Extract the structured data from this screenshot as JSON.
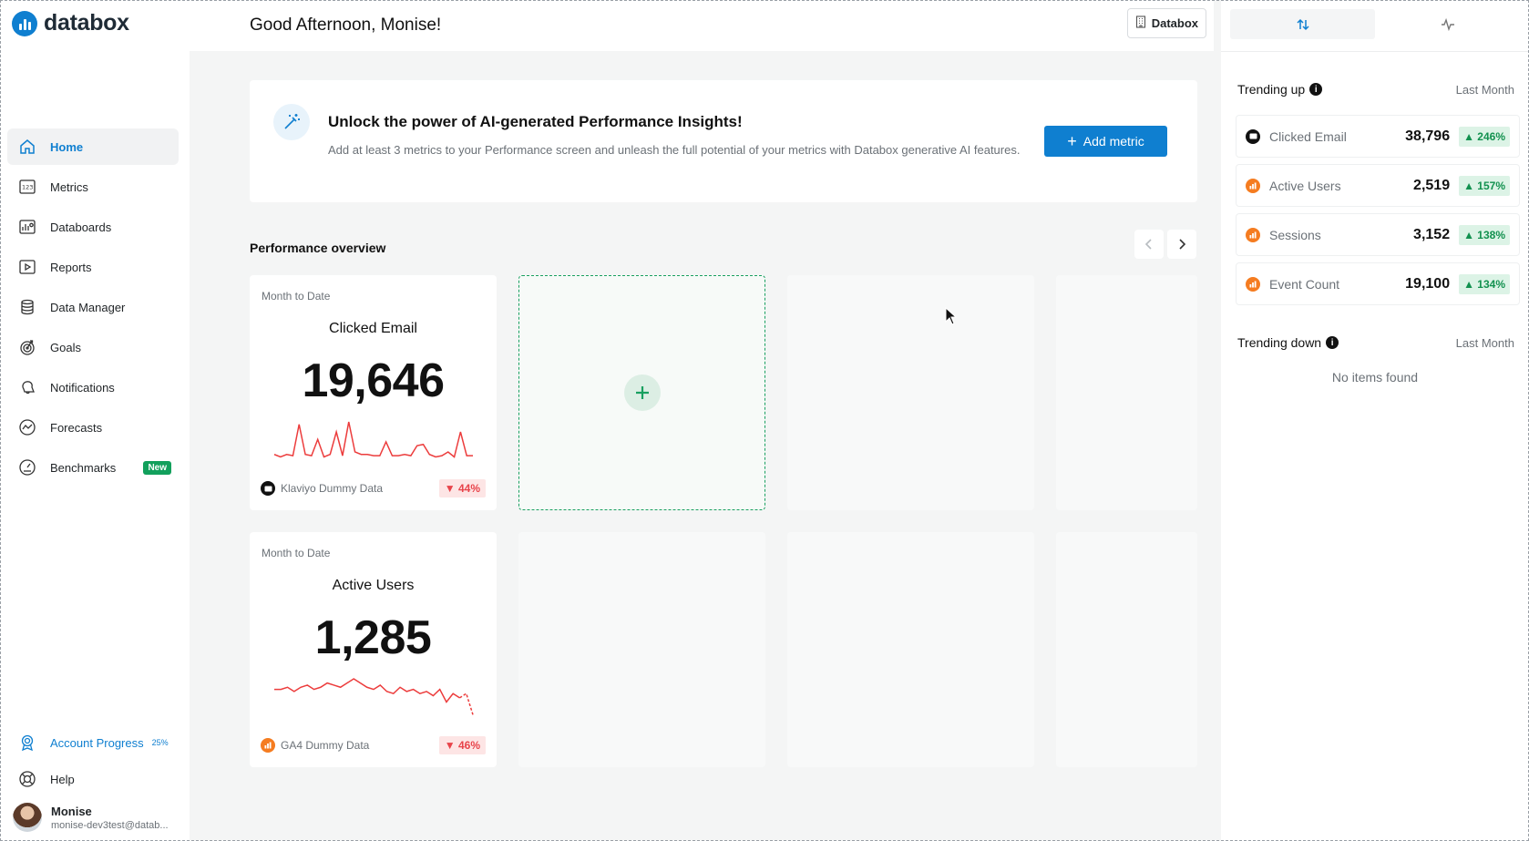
{
  "app": {
    "logo_text": "databox"
  },
  "header": {
    "greeting": "Good Afternoon, Monise!",
    "org_button": "Databox"
  },
  "nav": {
    "items": [
      {
        "id": "home",
        "label": "Home",
        "icon": "home-icon",
        "active": true
      },
      {
        "id": "metrics",
        "label": "Metrics",
        "icon": "metrics-icon"
      },
      {
        "id": "databoards",
        "label": "Databoards",
        "icon": "databoards-icon"
      },
      {
        "id": "reports",
        "label": "Reports",
        "icon": "reports-icon"
      },
      {
        "id": "data-manager",
        "label": "Data Manager",
        "icon": "database-icon"
      },
      {
        "id": "goals",
        "label": "Goals",
        "icon": "target-icon"
      },
      {
        "id": "notifications",
        "label": "Notifications",
        "icon": "bell-icon"
      },
      {
        "id": "forecasts",
        "label": "Forecasts",
        "icon": "forecast-icon"
      },
      {
        "id": "benchmarks",
        "label": "Benchmarks",
        "icon": "benchmark-icon",
        "badge": "New"
      }
    ],
    "account_progress": {
      "label": "Account Progress",
      "percent": "25%"
    },
    "help_label": "Help",
    "user": {
      "name": "Monise",
      "email": "monise-dev3test@datab..."
    }
  },
  "banner": {
    "title": "Unlock the power of AI-generated Performance Insights!",
    "description": "Add at least 3 metrics to your Performance screen and unleash the full potential of your metrics with Databox generative AI features.",
    "button_label": "Add metric"
  },
  "performance": {
    "title": "Performance overview",
    "cards": [
      {
        "period": "Month to Date",
        "name": "Clicked Email",
        "value": "19,646",
        "source": "Klaviyo Dummy Data",
        "change": "▼ 44%",
        "spark": [
          3,
          2,
          3,
          2.5,
          15,
          3,
          2.5,
          9,
          2,
          3,
          12,
          2.5,
          16,
          4,
          3,
          3,
          2.5,
          2.5,
          8,
          2.5,
          2.5,
          3,
          2.5,
          6.5,
          7,
          3,
          2,
          2.5,
          4,
          2,
          12,
          2.5,
          2.5
        ]
      },
      {
        "period": "Month to Date",
        "name": "Active Users",
        "value": "1,285",
        "source": "GA4 Dummy Data",
        "change": "▼ 46%",
        "spark": [
          14,
          14,
          15,
          13,
          15,
          16,
          14,
          15,
          17,
          16,
          15,
          17,
          19,
          17,
          15,
          14,
          16,
          13,
          12,
          15,
          13,
          14,
          12,
          13,
          11,
          14,
          8,
          12,
          10,
          12,
          2
        ]
      }
    ]
  },
  "trending_up": {
    "title": "Trending up",
    "period": "Last Month",
    "items": [
      {
        "name": "Clicked Email",
        "value": "38,796",
        "change": "▲ 246%",
        "source_icon": "klaviyo-icon"
      },
      {
        "name": "Active Users",
        "value": "2,519",
        "change": "▲ 157%",
        "source_icon": "ga4-icon"
      },
      {
        "name": "Sessions",
        "value": "3,152",
        "change": "▲ 138%",
        "source_icon": "ga4-icon"
      },
      {
        "name": "Event Count",
        "value": "19,100",
        "change": "▲ 134%",
        "source_icon": "ga4-icon"
      }
    ]
  },
  "trending_down": {
    "title": "Trending down",
    "period": "Last Month",
    "empty_text": "No items found"
  },
  "colors": {
    "brand": "#0f7fd0",
    "positive": "#12914f",
    "negative": "#e8434a",
    "add_accent": "#19a060"
  }
}
